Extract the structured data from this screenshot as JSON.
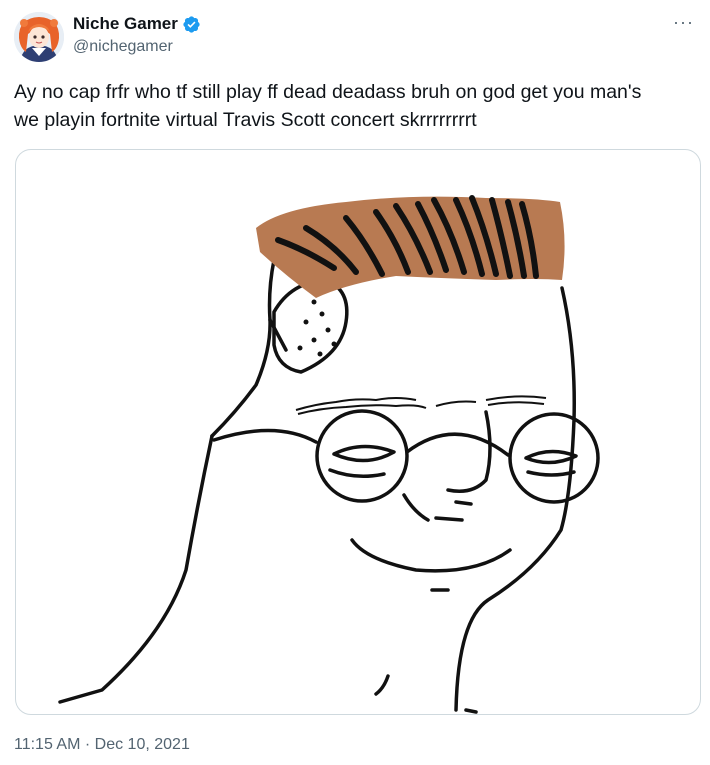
{
  "tweet": {
    "author": {
      "display_name": "Niche Gamer",
      "handle": "@nichegamer",
      "verified": true,
      "avatar": "anime-character-avatar"
    },
    "more_icon": "more-horizontal-icon",
    "text_line1": "Ay no cap frfr who tf still play ff dead deadass bruh on god get you man's",
    "text_line2": "we playin fortnite virtual Travis Scott concert skrrrrrrrrt",
    "media": {
      "description": "Wojak meme drawing with brown hair and round glasses"
    },
    "time": "11:15 AM",
    "separator": "·",
    "date": "Dec 10, 2021"
  },
  "colors": {
    "verified_blue": "#1d9bf0",
    "text_primary": "#0f1419",
    "text_secondary": "#536471",
    "hair_brown": "#b87a52"
  }
}
